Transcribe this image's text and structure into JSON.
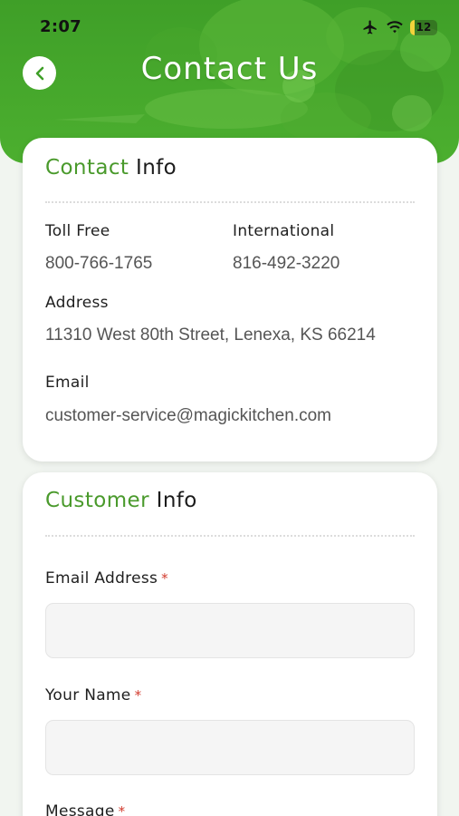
{
  "status_bar": {
    "time": "2:07",
    "battery": "12",
    "icons": [
      "airplane-icon",
      "wifi-icon",
      "battery-icon"
    ]
  },
  "header": {
    "title": "Contact Us",
    "back_icon": "chevron-left-icon",
    "background_color": "#47a82c"
  },
  "contact_info": {
    "heading_accent": "Contact",
    "heading_rest": " Info",
    "toll_free_label": "Toll Free",
    "toll_free_value": "800-766-1765",
    "international_label": "International",
    "international_value": "816-492-3220",
    "address_label": "Address",
    "address_value": "11310 West 80th Street, Lenexa, KS 66214",
    "email_label": "Email",
    "email_value": "customer-service@magickitchen.com"
  },
  "customer_info": {
    "heading_accent": "Customer",
    "heading_rest": " Info",
    "fields": [
      {
        "label": "Email Address",
        "required_mark": "*",
        "value": ""
      },
      {
        "label": "Your Name",
        "required_mark": "*",
        "value": ""
      },
      {
        "label": "Message",
        "required_mark": "*"
      }
    ]
  },
  "colors": {
    "accent_green": "#4a9a2c",
    "required_red": "#d23b2e"
  }
}
